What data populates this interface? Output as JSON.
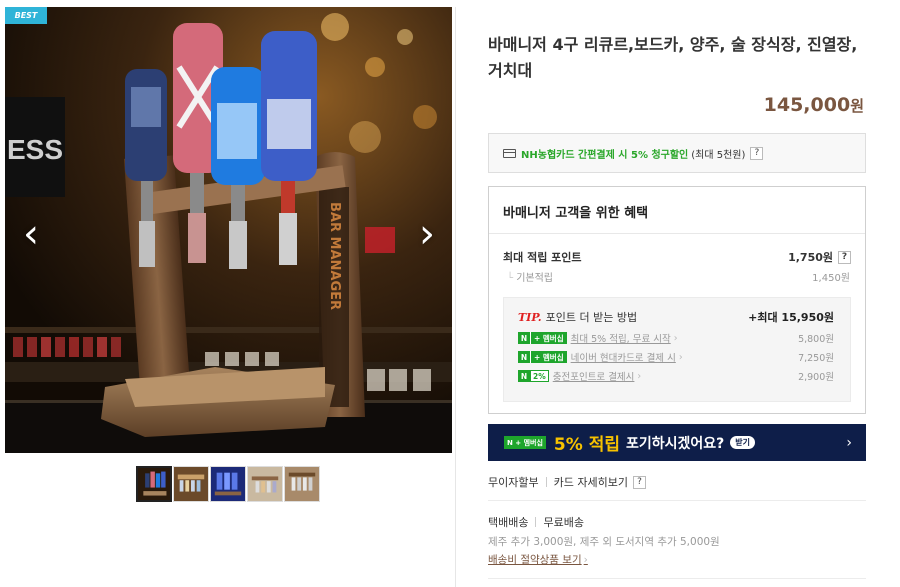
{
  "gallery": {
    "badge": "BEST",
    "prev_arrow": "‹",
    "next_arrow": "›",
    "photo_text": "BAR MANAGER",
    "sign_text": "ESS",
    "thumbnail_count": 5,
    "active_thumbnail": 0
  },
  "product": {
    "title": "바매니저 4구 리큐르,보드카, 양주, 술 장식장, 진열장, 거치대",
    "price": "145,000",
    "price_unit": "원"
  },
  "card_promo": {
    "icon": "credit-card-icon",
    "highlight": "NH농협카드 간편결제 시 5% 청구할인",
    "note": "(최대 5천원)",
    "help": "?"
  },
  "benefits": {
    "title": "바매니저 고객을 위한 혜택",
    "max_points_label": "최대 적립 포인트",
    "max_points_value": "1,750원",
    "help": "?",
    "basic_label": "기본적립",
    "basic_value": "1,450원",
    "tip": {
      "tip_label": "TIP.",
      "heading": "포인트 더 받는 방법",
      "max": "+최대 15,950원",
      "rows": [
        {
          "badge_n": "N",
          "badge_plus": "+ 멤버십",
          "label": "최대 5% 적립, 무료 시작",
          "value": "5,800원"
        },
        {
          "badge_n": "N",
          "badge_plus": "+ 멤버십",
          "label": "네이버 현대카드로 결제 시",
          "value": "7,250원"
        },
        {
          "badge_n": "N",
          "badge_plus": "2%",
          "label": "충전포인트로 결제시",
          "value": "2,900원"
        }
      ],
      "chevron": "›"
    }
  },
  "banner": {
    "badge": "N + 멤버십",
    "highlight": "5% 적립",
    "message": "포기하시겠어요?",
    "pill": "받기",
    "arrow": "›"
  },
  "payment": {
    "installment": "무이자할부",
    "card_detail": "카드 자세히보기",
    "help": "?"
  },
  "shipping": {
    "method": "택배배송",
    "fee": "무료배송",
    "extra": "제주 추가 3,000원, 제주 외 도서지역 추가 5,000원",
    "link": "배송비 절약상품 보기",
    "chevron": "›"
  },
  "colors": {
    "badge_blue": "#2fb4d8",
    "price_brown": "#7a5640",
    "naver_green": "#1ea52c",
    "banner_navy": "#0e1e49",
    "banner_yellow": "#f7c200",
    "tip_red": "#e02020"
  }
}
